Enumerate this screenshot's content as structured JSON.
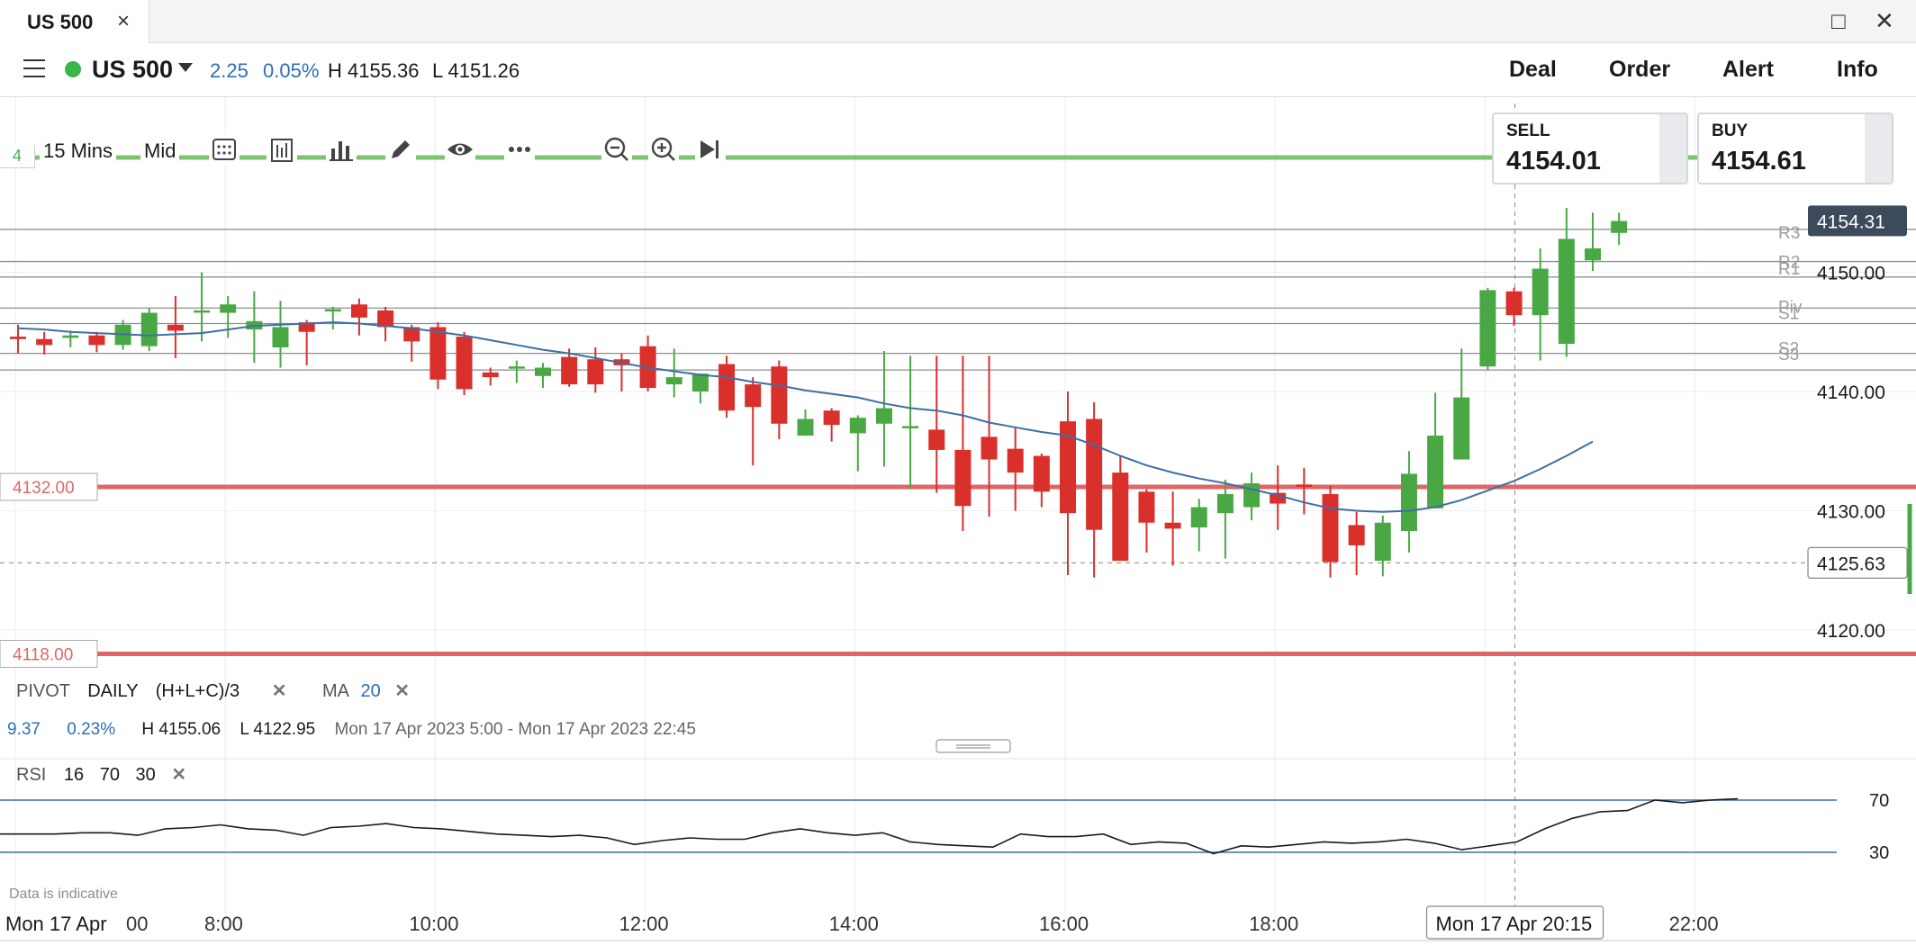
{
  "window": {
    "tab_title": "US 500",
    "close_icon": "×",
    "maximize_icon": "□",
    "window_close_icon": "✕"
  },
  "instrument": {
    "name": "US 500",
    "change": "2.25",
    "change_pct": "0.05%",
    "high": "H 4155.36",
    "low": "L 4151.26"
  },
  "header_menu": [
    "Deal",
    "Order",
    "Alert",
    "Info"
  ],
  "toolbar": {
    "number": "4",
    "interval": "15 Mins",
    "price_type": "Mid"
  },
  "quote": {
    "sell_label": "SELL",
    "sell_price": "4154.01",
    "buy_label": "BUY",
    "buy_price": "4154.61"
  },
  "levels": {
    "upper_alert": "4132.00",
    "lower_alert": "4118.00",
    "current_price": "4154.31",
    "crosshair_price": "4125.63"
  },
  "pivot_labels": [
    "R3",
    "R2",
    "R1",
    "Piv",
    "S1",
    "S2",
    "S3"
  ],
  "y_axis_labels": [
    "4150.00",
    "4140.00",
    "4130.00",
    "4120.00"
  ],
  "x_axis_labels": [
    "00",
    "8:00",
    "10:00",
    "12:00",
    "14:00",
    "16:00",
    "18:00",
    "22:00"
  ],
  "x_axis_date": "Mon 17 Apr",
  "crosshair_time": "Mon 17 Apr 20:15",
  "indicators": {
    "pivot": {
      "name": "PIVOT",
      "period": "DAILY",
      "formula": "(H+L+C)/3"
    },
    "ma": {
      "name": "MA",
      "period": "20"
    },
    "close_glyph": "✕"
  },
  "stats": {
    "change": "9.37",
    "change_pct": "0.23%",
    "high": "H 4155.06",
    "low": "L 4122.95",
    "range": "Mon 17 Apr 2023 5:00 - Mon 17 Apr 2023 22:45"
  },
  "rsi": {
    "name": "RSI",
    "period": "16",
    "upper": "70",
    "lower": "30",
    "upper_label": "70",
    "lower_label": "30"
  },
  "disclaimer": "Data is indicative",
  "colors": {
    "up": "#4aa844",
    "down": "#d9302b",
    "ma": "#3d6fa6",
    "alert": "#e06666",
    "accent_blue": "#2c6fb5"
  },
  "chart_data": {
    "type": "candlestick",
    "interval": "15 Mins",
    "x": [
      "6:00",
      "6:15",
      "6:30",
      "6:45",
      "7:00",
      "7:15",
      "7:30",
      "7:45",
      "8:00",
      "8:15",
      "8:30",
      "8:45",
      "9:00",
      "9:15",
      "9:30",
      "9:45",
      "10:00",
      "10:15",
      "10:30",
      "10:45",
      "11:00",
      "11:15",
      "11:30",
      "11:45",
      "12:00",
      "12:15",
      "12:30",
      "12:45",
      "13:00",
      "13:15",
      "13:30",
      "13:45",
      "14:00",
      "14:15",
      "14:30",
      "14:45",
      "15:00",
      "15:15",
      "15:30",
      "15:45",
      "16:00",
      "16:15",
      "16:30",
      "16:45",
      "17:00",
      "17:15",
      "17:30",
      "17:45",
      "18:00",
      "18:15",
      "18:30",
      "18:45",
      "19:00",
      "19:15",
      "19:30",
      "19:45",
      "20:00",
      "20:15",
      "20:30",
      "20:45",
      "21:00",
      "21:15"
    ],
    "open": [
      4144.6,
      4144.4,
      4144.5,
      4144.7,
      4143.9,
      4143.8,
      4145.6,
      4146.8,
      4146.6,
      4145.2,
      4143.7,
      4145.8,
      4146.8,
      4147.3,
      4146.8,
      4145.4,
      4145.4,
      4144.6,
      4141.6,
      4142.1,
      4141.3,
      4142.9,
      4142.7,
      4142.7,
      4143.8,
      4140.6,
      4140.0,
      4142.3,
      4140.6,
      4142.1,
      4136.3,
      4138.4,
      4136.5,
      4137.3,
      4137.0,
      4136.8,
      4135.1,
      4136.2,
      4135.2,
      4134.6,
      4137.5,
      4137.7,
      4133.2,
      4131.6,
      4129.0,
      4128.6,
      4129.8,
      4130.3,
      4131.5,
      4132.2,
      4131.4,
      4128.8,
      4125.8,
      4128.3,
      4130.2,
      4134.3,
      4142.1,
      4148.4,
      4146.4,
      4144.0,
      4151.0,
      4153.3
    ],
    "close": [
      4144.4,
      4143.9,
      4144.7,
      4143.9,
      4145.6,
      4146.6,
      4145.1,
      4146.8,
      4147.3,
      4145.9,
      4145.4,
      4145.0,
      4146.9,
      4146.2,
      4145.4,
      4144.2,
      4141.0,
      4140.2,
      4141.2,
      4142.1,
      4142.0,
      4140.6,
      4140.6,
      4142.2,
      4140.3,
      4141.2,
      4141.5,
      4138.4,
      4138.7,
      4137.3,
      4137.7,
      4137.2,
      4137.8,
      4138.6,
      4137.1,
      4135.1,
      4130.4,
      4134.3,
      4133.2,
      4131.6,
      4129.8,
      4128.4,
      4125.8,
      4129.0,
      4128.5,
      4130.3,
      4131.4,
      4132.3,
      4130.6,
      4132.0,
      4125.7,
      4127.1,
      4129.0,
      4133.1,
      4136.3,
      4139.5,
      4148.5,
      4146.4,
      4150.3,
      4152.8,
      4152.0,
      4154.3
    ],
    "high": [
      4145.6,
      4145.0,
      4145.1,
      4145.0,
      4146.0,
      4147.0,
      4148.0,
      4150.0,
      4148.0,
      4148.4,
      4147.6,
      4146.0,
      4147.1,
      4147.8,
      4147.1,
      4145.6,
      4145.8,
      4145.0,
      4142.0,
      4142.6,
      4142.4,
      4143.6,
      4143.7,
      4143.2,
      4144.7,
      4143.6,
      4141.0,
      4143.0,
      4141.2,
      4142.6,
      4138.5,
      4138.6,
      4138.0,
      4143.4,
      4143.0,
      4143.0,
      4143.0,
      4143.0,
      4137.0,
      4134.8,
      4140.0,
      4139.1,
      4134.6,
      4131.8,
      4131.6,
      4131.0,
      4132.6,
      4133.2,
      4133.8,
      4133.6,
      4132.1,
      4129.9,
      4129.6,
      4135.0,
      4139.9,
      4143.6,
      4148.7,
      4148.7,
      4152.0,
      4155.4,
      4155.0,
      4155.0
    ],
    "low": [
      4143.2,
      4143.1,
      4143.7,
      4143.3,
      4143.5,
      4143.4,
      4142.8,
      4144.2,
      4144.5,
      4142.4,
      4142.0,
      4142.2,
      4145.2,
      4144.7,
      4144.2,
      4142.5,
      4140.2,
      4139.7,
      4140.5,
      4140.7,
      4140.3,
      4140.4,
      4139.9,
      4140.0,
      4140.0,
      4139.5,
      4139.0,
      4137.8,
      4133.8,
      4136.0,
      4136.6,
      4135.8,
      4133.3,
      4133.7,
      4131.8,
      4131.5,
      4128.3,
      4129.5,
      4130.0,
      4130.3,
      4124.6,
      4124.4,
      4126.2,
      4126.5,
      4125.4,
      4126.6,
      4126.0,
      4129.2,
      4128.4,
      4129.7,
      4124.4,
      4124.6,
      4124.5,
      4126.5,
      4130.6,
      4135.2,
      4141.8,
      4145.5,
      4142.6,
      4142.9,
      4150.1,
      4152.3
    ],
    "ma": [
      4145.3,
      4145.2,
      4145.0,
      4144.9,
      4144.8,
      4144.7,
      4144.8,
      4144.9,
      4145.2,
      4145.5,
      4145.6,
      4145.7,
      4145.8,
      4145.7,
      4145.5,
      4145.3,
      4145.0,
      4144.7,
      4144.3,
      4143.9,
      4143.5,
      4143.2,
      4142.8,
      4142.4,
      4142.0,
      4141.7,
      4141.4,
      4141.2,
      4140.8,
      4140.5,
      4140.1,
      4139.8,
      4139.5,
      4139.0,
      4138.6,
      4138.4,
      4138.0,
      4137.4,
      4137.0,
      4136.6,
      4136.3,
      4135.5,
      4134.6,
      4133.8,
      4133.2,
      4132.7,
      4132.3,
      4131.8,
      4131.3,
      4130.7,
      4130.2,
      4130.0,
      4129.9,
      4130.0,
      4130.3,
      4130.9,
      4131.7,
      4132.5,
      4133.5,
      4134.6,
      4135.8
    ],
    "pivots": {
      "R3": 4153.6,
      "R2": 4150.9,
      "R1": 4149.6,
      "Piv": 4147.0,
      "S1": 4145.7,
      "S2": 4143.2,
      "S3": 4141.8
    },
    "rsi_values": [
      44,
      44,
      44,
      45,
      45,
      43,
      48,
      49,
      51,
      48,
      47,
      43,
      49,
      50,
      52,
      49,
      48,
      46,
      44,
      43,
      42,
      43,
      41,
      36,
      39,
      41,
      40,
      40,
      45,
      48,
      45,
      43,
      45,
      38,
      36,
      35,
      34,
      44,
      42,
      42,
      44,
      36,
      38,
      37,
      29,
      35,
      34,
      36,
      38,
      37,
      38,
      40,
      37,
      32,
      35,
      38,
      48,
      56,
      61,
      62,
      70,
      68,
      70,
      71
    ],
    "y_range": [
      4115.0,
      4157.0
    ],
    "rsi_range": [
      0,
      100
    ]
  }
}
